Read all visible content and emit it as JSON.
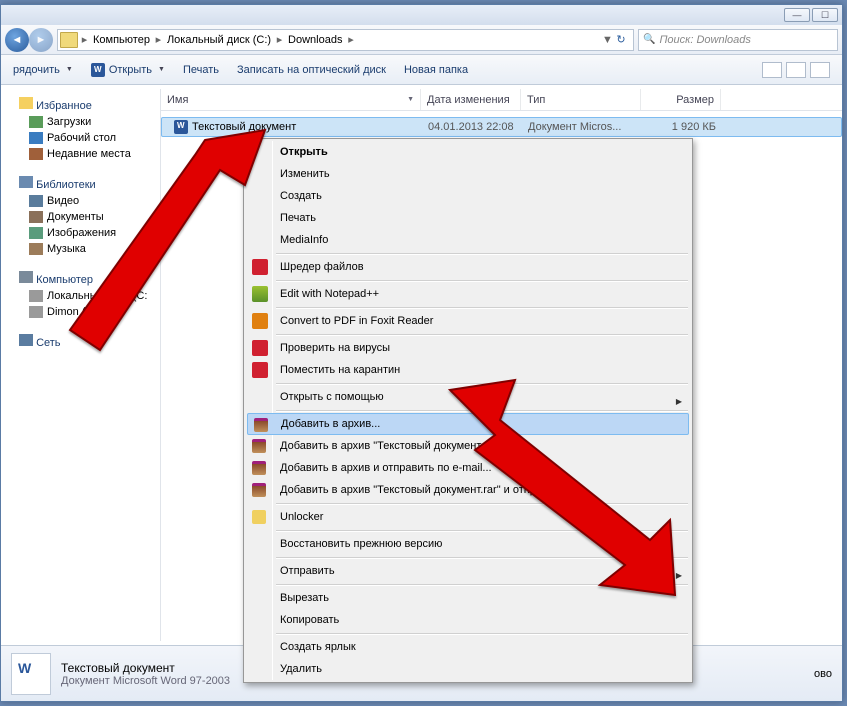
{
  "window": {
    "minimize": "—",
    "maximize": "☐",
    "close": "✕"
  },
  "breadcrumb": {
    "items": [
      "Компьютер",
      "Локальный диск (C:)",
      "Downloads"
    ],
    "sep": "▸",
    "refresh": "↻"
  },
  "search": {
    "placeholder": "Поиск: Downloads"
  },
  "toolbar": {
    "organize": "рядочить",
    "open": "Открыть",
    "print": "Печать",
    "burn": "Записать на оптический диск",
    "newfolder": "Новая папка"
  },
  "sidebar": {
    "favorites": {
      "head": "Избранное",
      "items": [
        "Загрузки",
        "Рабочий стол",
        "Недавние места"
      ]
    },
    "libraries": {
      "head": "Библиотеки",
      "items": [
        "Видео",
        "Документы",
        "Изображения",
        "Музыка"
      ]
    },
    "computer": {
      "head": "Компьютер",
      "items": [
        "Локальный диск (C:",
        "Dimon (D:)"
      ]
    },
    "network": {
      "head": "Сеть"
    }
  },
  "columns": {
    "name": "Имя",
    "date": "Дата изменения",
    "type": "Тип",
    "size": "Размер"
  },
  "file": {
    "name": "Текстовый документ",
    "date": "04.01.2013 22:08",
    "type": "Документ Micros...",
    "size": "1 920 КБ"
  },
  "context_menu": {
    "open": "Открыть",
    "edit": "Изменить",
    "create": "Создать",
    "print": "Печать",
    "mediainfo": "MediaInfo",
    "shredder": "Шредер файлов",
    "npp": "Edit with Notepad++",
    "foxit": "Convert to PDF in Foxit Reader",
    "virus": "Проверить на вирусы",
    "quarantine": "Поместить на карантин",
    "openwith": "Открыть с помощью",
    "addarchive": "Добавить в архив...",
    "addarchive_named": "Добавить в архив \"Текстовый документ.rar\"",
    "archive_email": "Добавить в архив и отправить по e-mail...",
    "archive_named_send": "Добавить в архив \"Текстовый документ.rar\" и отправить",
    "unlocker": "Unlocker",
    "restore": "Восстановить прежнюю версию",
    "sendto": "Отправить",
    "cut": "Вырезать",
    "copy": "Копировать",
    "shortcut": "Создать ярлык",
    "delete": "Удалить"
  },
  "statusbar": {
    "title": "Текстовый документ",
    "subtitle": "Документ Microsoft Word 97-2003",
    "extra": "ово"
  }
}
